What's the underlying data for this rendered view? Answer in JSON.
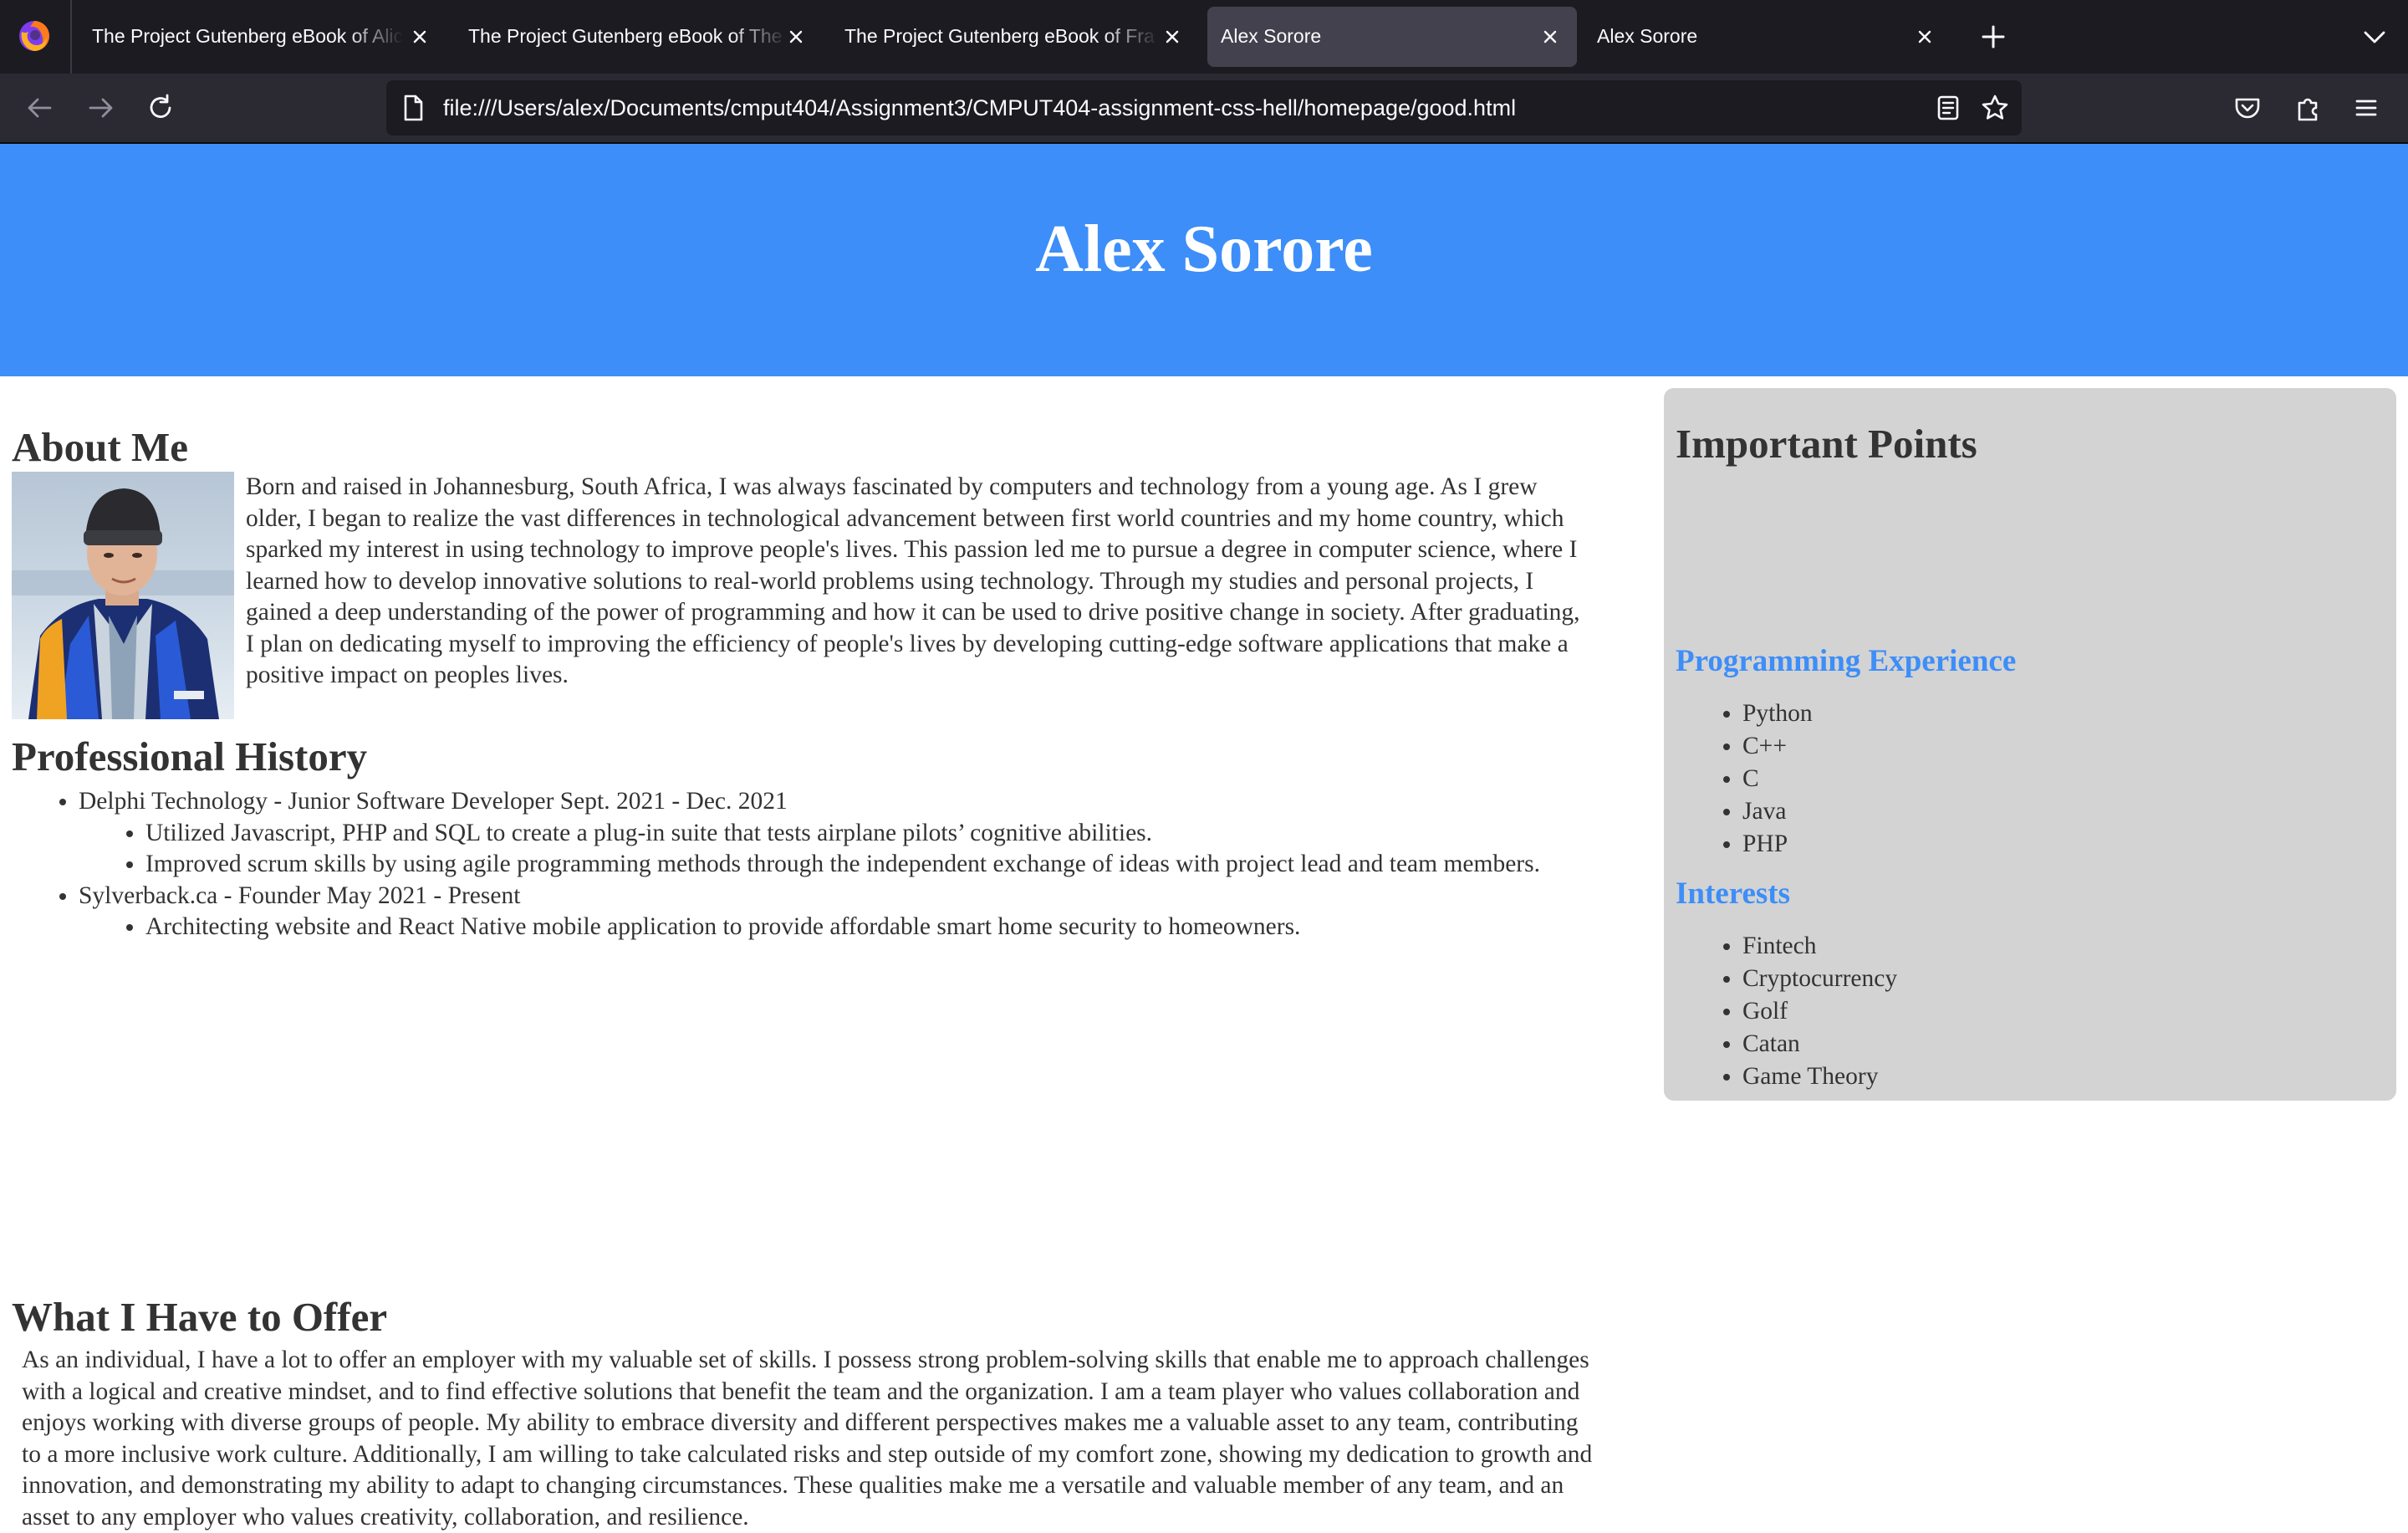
{
  "browser": {
    "tabs": [
      {
        "title": "The Project Gutenberg eBook of Alic",
        "active": false
      },
      {
        "title": "The Project Gutenberg eBook of The",
        "active": false
      },
      {
        "title": "The Project Gutenberg eBook of Fra",
        "active": false
      },
      {
        "title": "Alex Sorore",
        "active": true
      },
      {
        "title": "Alex Sorore",
        "active": false
      }
    ],
    "url": "file:///Users/alex/Documents/cmput404/Assignment3/CMPUT404-assignment-css-hell/homepage/good.html"
  },
  "colors": {
    "header_bg": "#3d8ef8",
    "accent": "#3d8ef8",
    "sidebar_bg": "#d3d3d3",
    "text": "#333333"
  },
  "header": {
    "title": "Alex Sorore"
  },
  "about": {
    "heading": "About Me",
    "text": "Born and raised in Johannesburg, South Africa, I was always fascinated by computers and technology from a young age. As I grew older, I began to realize the vast differences in technological advancement between first world countries and my home country, which sparked my interest in using technology to improve people's lives. This passion led me to pursue a degree in computer science, where I learned how to develop innovative solutions to real-world problems using technology. Through my studies and personal projects, I gained a deep understanding of the power of programming and how it can be used to drive positive change in society. After graduating, I plan on dedicating myself to improving the efficiency of people's lives by developing cutting-edge software applications that make a positive impact on peoples lives."
  },
  "history": {
    "heading": "Professional History",
    "jobs": [
      {
        "title": "Delphi Technology - Junior Software Developer Sept. 2021 - Dec. 2021",
        "details": [
          "Utilized Javascript, PHP and SQL to create a plug-in suite that tests airplane pilots’ cognitive abilities.",
          "Improved scrum skills by using agile programming methods through the independent exchange of ideas with project lead and team members."
        ]
      },
      {
        "title": "Sylverback.ca - Founder May 2021 - Present",
        "details": [
          "Architecting website and React Native mobile application to provide affordable smart home security to homeowners."
        ]
      }
    ]
  },
  "offer": {
    "heading": "What I Have to Offer",
    "text": "As an individual, I have a lot to offer an employer with my valuable set of skills. I possess strong problem-solving skills that enable me to approach challenges with a logical and creative mindset, and to find effective solutions that benefit the team and the organization. I am a team player who values collaboration and enjoys working with diverse groups of people. My ability to embrace diversity and different perspectives makes me a valuable asset to any team, contributing to a more inclusive work culture. Additionally, I am willing to take calculated risks and step outside of my comfort zone, showing my dedication to growth and innovation, and demonstrating my ability to adapt to changing circumstances. These qualities make me a versatile and valuable member of any team, and an asset to any employer who values creativity, collaboration, and resilience."
  },
  "sidebar": {
    "heading": "Important Points",
    "programming": {
      "heading": "Programming Experience",
      "items": [
        "Python",
        "C++",
        "C",
        "Java",
        "PHP"
      ]
    },
    "interests": {
      "heading": "Interests",
      "items": [
        "Fintech",
        "Cryptocurrency",
        "Golf",
        "Catan",
        "Game Theory"
      ]
    }
  }
}
